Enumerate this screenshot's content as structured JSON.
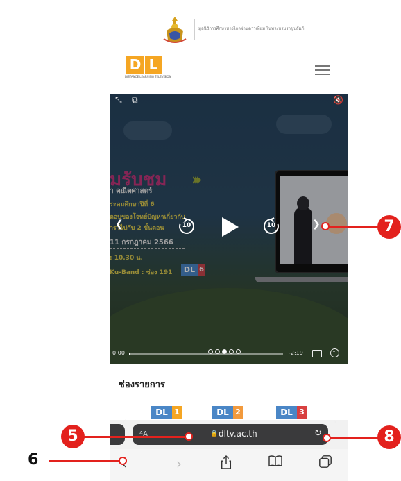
{
  "header": {
    "foundation_text": "มูลนิธิการศึกษาทางไกลผ่านดาวเทียม ในพระบรมราชูปถัมภ์",
    "logo_letters": "DL",
    "logo_caption": "DISTANCE LEARNING TELEVISION",
    "menu_icon": "hamburger-icon"
  },
  "video": {
    "promo_title": "มรับชม",
    "promo_subject": "า คณิตศาสตร์",
    "promo_grade": "ระดมศึกษาปีที่ 6",
    "promo_topic_1": "ตอบของโจทย์ปัญหาเกี่ยวกับ",
    "promo_topic_2": "ารวิไปกับ 2 ขั้นตอน",
    "promo_date": "11 กรกฎาคม 2566",
    "promo_time": ": 10.30 น.",
    "promo_channel": "Ku-Band : ช่อง 191",
    "badge_letters": "DL",
    "badge_num": "6",
    "skip_back_seconds": "10",
    "skip_forward_seconds": "10",
    "time_elapsed": "0:00",
    "time_remaining": "-2:19",
    "progress_fraction": 0.01
  },
  "channels": {
    "heading": "ช่องรายการ",
    "items": [
      {
        "letters": "DL",
        "num": "1",
        "color": "#f5a623"
      },
      {
        "letters": "DL",
        "num": "2",
        "color": "#f29a3d"
      },
      {
        "letters": "DL",
        "num": "3",
        "color": "#d84040"
      }
    ]
  },
  "safari": {
    "aa_label": "ᴬA",
    "url": "dltv.ac.th",
    "lock_icon": "lock-icon",
    "reload_icon": "reload-icon"
  },
  "toolbar": {
    "back_icon": "back-icon",
    "forward_icon": "forward-icon",
    "share_icon": "share-icon",
    "bookmarks_icon": "bookmarks-icon",
    "tabs_icon": "tabs-icon"
  },
  "callouts": [
    {
      "number": "5"
    },
    {
      "number": "6"
    },
    {
      "number": "7"
    },
    {
      "number": "8"
    }
  ],
  "colors": {
    "callout_red": "#e3211d",
    "dltv_orange": "#f5a623",
    "dltv_blue": "#4a86c6"
  }
}
